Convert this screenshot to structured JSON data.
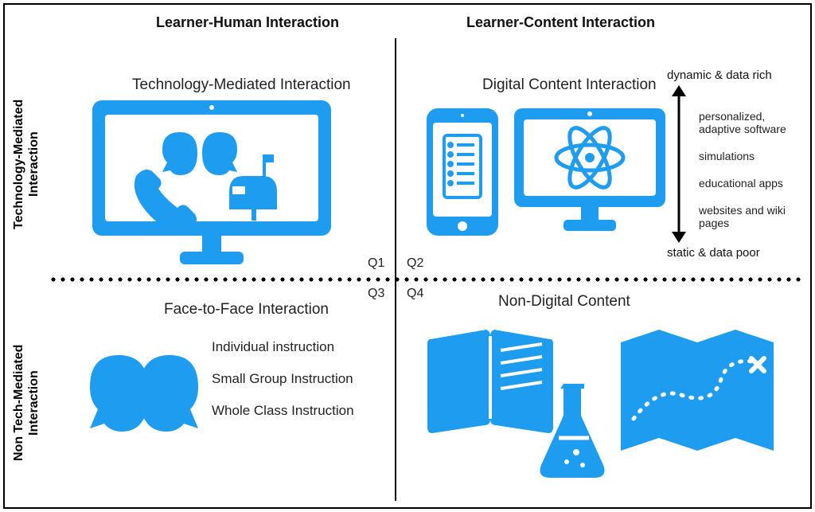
{
  "columns": {
    "left": "Learner-Human Interaction",
    "right": "Learner-Content Interaction"
  },
  "rows": {
    "top": "Technology-Mediated Interaction",
    "bottom": "Non Tech-Mediated Interaction"
  },
  "quadrants": {
    "q1": {
      "code": "Q1",
      "title": "Technology-Mediated Interaction"
    },
    "q2": {
      "code": "Q2",
      "title": "Digital Content Interaction"
    },
    "q3": {
      "code": "Q3",
      "title": "Face-to-Face Interaction"
    },
    "q4": {
      "code": "Q4",
      "title": "Non-Digital Content"
    }
  },
  "q3_list": [
    "Individual instruction",
    "Small Group Instruction",
    "Whole Class Instruction"
  ],
  "arrow": {
    "top": "dynamic & data rich",
    "bottom": "static & data poor",
    "items": [
      "personalized, adaptive software",
      "simulations",
      "educational apps",
      "websites and wiki pages"
    ]
  },
  "icons": {
    "q1": [
      "monitor",
      "two-heads",
      "phone",
      "mailbox"
    ],
    "q2": [
      "smartphone-list",
      "monitor-atom"
    ],
    "q3": [
      "two-heads"
    ],
    "q4": [
      "open-book",
      "flask",
      "folded-map"
    ]
  }
}
